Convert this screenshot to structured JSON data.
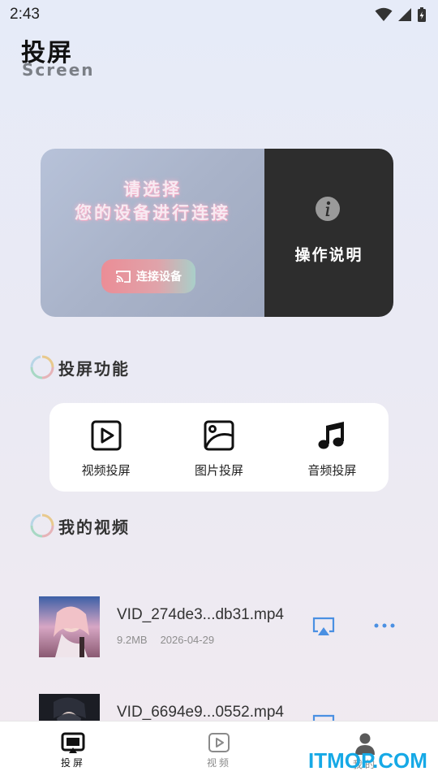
{
  "status_bar": {
    "time": "2:43"
  },
  "header": {
    "title": "投屏",
    "subtitle": "Screen"
  },
  "banner": {
    "line1": "请选择",
    "line2": "您的设备进行连接",
    "connect_button": "连接设备",
    "guide_label": "操作说明"
  },
  "sections": {
    "features_title": "投屏功能",
    "videos_title": "我的视频"
  },
  "features": [
    {
      "label": "视频投屏",
      "icon": "video-play-icon"
    },
    {
      "label": "图片投屏",
      "icon": "image-icon"
    },
    {
      "label": "音频投屏",
      "icon": "music-note-icon"
    }
  ],
  "videos": [
    {
      "name": "VID_274de3...db31.mp4",
      "size": "9.2MB",
      "date": "2026-04-29"
    },
    {
      "name": "VID_6694e9...0552.mp4",
      "size": "",
      "date": ""
    }
  ],
  "bottom_nav": {
    "items": [
      {
        "label": "投屏",
        "active": true
      },
      {
        "label": "视频",
        "active": false
      },
      {
        "label": "我的",
        "active": false
      }
    ]
  },
  "watermark": "ITMOP.COM",
  "colors": {
    "accent_blue": "#4a90e2",
    "banner_dark": "#2d2d2d",
    "watermark": "#16a9e6"
  }
}
